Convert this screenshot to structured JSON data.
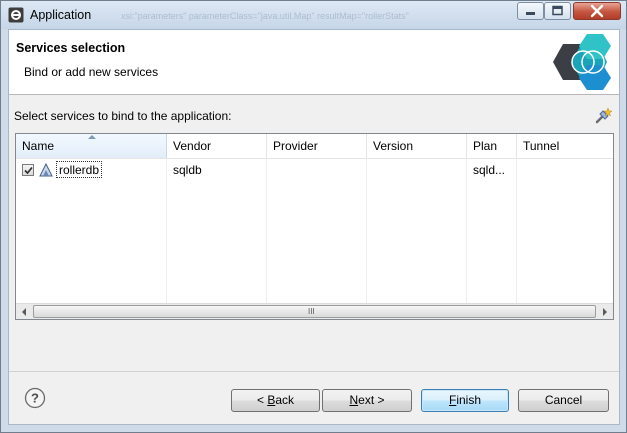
{
  "window": {
    "title": "Application",
    "ghost_text": "xsi:\"parameters\" parameterClass=\"java.util.Map\" resultMap=\"rollerStats\""
  },
  "header": {
    "title": "Services selection",
    "description": "Bind or add new services"
  },
  "select_label": "Select services to bind to the application:",
  "table": {
    "columns": [
      "Name",
      "Vendor",
      "Provider",
      "Version",
      "Plan",
      "Tunnel"
    ],
    "sorted_column": "Name",
    "rows": [
      {
        "checked": true,
        "name": "rollerdb",
        "vendor": "sqldb",
        "provider": "",
        "version": "",
        "plan": "sqld...",
        "tunnel": ""
      }
    ],
    "scroll_grip": "III"
  },
  "buttons": {
    "back": {
      "prefix": "< ",
      "mnemonic": "B",
      "rest": "ack"
    },
    "next": {
      "mnemonic": "N",
      "rest": "ext >"
    },
    "finish": {
      "mnemonic": "F",
      "rest": "inish"
    },
    "cancel": "Cancel"
  },
  "icons": [
    "app-icon",
    "minimize-icon",
    "maximize-icon",
    "close-icon",
    "bluemix-logo",
    "add-service-icon",
    "service-icon",
    "help-icon"
  ]
}
